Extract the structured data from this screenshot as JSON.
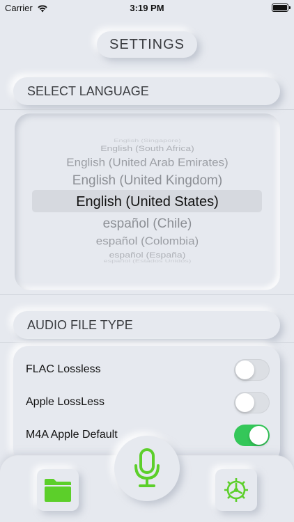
{
  "status_bar": {
    "carrier": "Carrier",
    "time": "3:19 PM"
  },
  "header": {
    "title": "SETTINGS"
  },
  "language_section": {
    "label": "SELECT LANGUAGE",
    "options": [
      "English (Singapore)",
      "English (South Africa)",
      "English (United Arab Emirates)",
      "English (United Kingdom)",
      "English (United States)",
      "español (Chile)",
      "español (Colombia)",
      "español (España)",
      "español (Estados Unidos)"
    ],
    "selected": "English (United States)"
  },
  "audio_section": {
    "label": "AUDIO FILE TYPE",
    "options": [
      {
        "label": "FLAC Lossless",
        "enabled": false
      },
      {
        "label": "Apple LossLess",
        "enabled": false
      },
      {
        "label": "M4A Apple Default",
        "enabled": true
      }
    ]
  },
  "tab_bar": {
    "icons": [
      "folder-icon",
      "microphone-icon",
      "gear-icon"
    ],
    "accent_color": "#5ccf2a"
  }
}
